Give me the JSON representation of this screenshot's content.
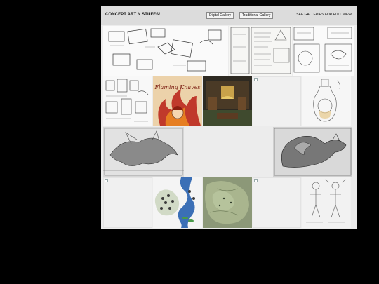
{
  "header": {
    "title": "CONCEPT ART N STUFFS!",
    "digital_label": "Digital Gallery",
    "traditional_label": "Traditional Gallery",
    "see_all_label": "SEE GALLERIES FOR FULL VIEW"
  },
  "tiles": [
    {
      "name": "sketch-books-tile",
      "kind": "sketch"
    },
    {
      "name": "sketch-menu-page-tile",
      "kind": "sketch"
    },
    {
      "name": "sketch-icons-tile",
      "kind": "sketch"
    },
    {
      "name": "sketch-jars-tile",
      "kind": "sketch"
    },
    {
      "name": "flaming-knaves-tile",
      "kind": "color",
      "heading": "Flaming Knaves"
    },
    {
      "name": "tavern-room-tile",
      "kind": "color"
    },
    {
      "name": "broken-image-tile",
      "kind": "broken"
    },
    {
      "name": "sketch-potion-bottle-tile",
      "kind": "sketch"
    },
    {
      "name": "dragon-sketch-tile",
      "kind": "sketch"
    },
    {
      "name": "serpent-sketch-tile",
      "kind": "sketch"
    },
    {
      "name": "broken-image-tile",
      "kind": "broken"
    },
    {
      "name": "island-map-tile",
      "kind": "color"
    },
    {
      "name": "terrain-map-tile",
      "kind": "color"
    },
    {
      "name": "broken-image-tile",
      "kind": "broken"
    },
    {
      "name": "figure-sketch-tile",
      "kind": "sketch"
    }
  ]
}
